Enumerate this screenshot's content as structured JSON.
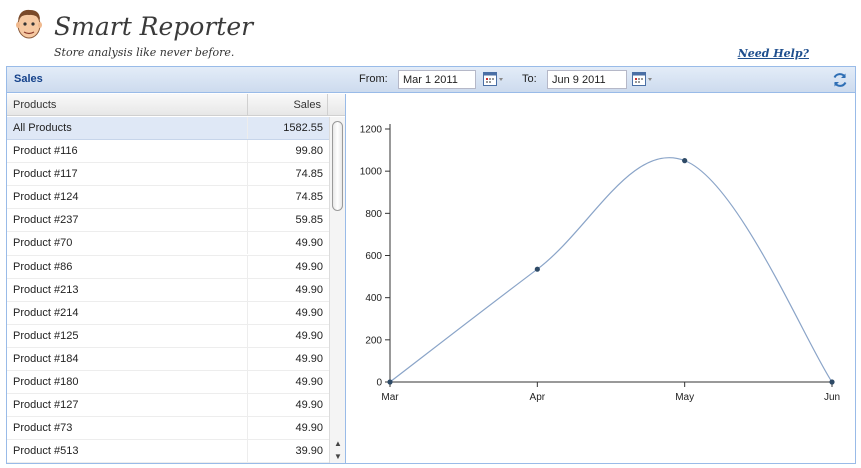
{
  "app": {
    "title": "Smart Reporter",
    "tagline": "Store analysis like never before.",
    "help_link": "Need Help?"
  },
  "toolbar": {
    "panel_title": "Sales",
    "from_label": "From:",
    "from_value": "Mar 1 2011",
    "to_label": "To:",
    "to_value": "Jun 9 2011"
  },
  "grid": {
    "columns": [
      "Products",
      "Sales"
    ],
    "rows": [
      {
        "product": "All Products",
        "sales": "1582.55",
        "selected": true
      },
      {
        "product": "Product #116",
        "sales": "99.80"
      },
      {
        "product": "Product #117",
        "sales": "74.85"
      },
      {
        "product": "Product #124",
        "sales": "74.85"
      },
      {
        "product": "Product #237",
        "sales": "59.85"
      },
      {
        "product": "Product #70",
        "sales": "49.90"
      },
      {
        "product": "Product #86",
        "sales": "49.90"
      },
      {
        "product": "Product #213",
        "sales": "49.90"
      },
      {
        "product": "Product #214",
        "sales": "49.90"
      },
      {
        "product": "Product #125",
        "sales": "49.90"
      },
      {
        "product": "Product #184",
        "sales": "49.90"
      },
      {
        "product": "Product #180",
        "sales": "49.90"
      },
      {
        "product": "Product #127",
        "sales": "49.90"
      },
      {
        "product": "Product #73",
        "sales": "49.90"
      },
      {
        "product": "Product #513",
        "sales": "39.90"
      }
    ]
  },
  "icons": {
    "mascot": "mascot-face-icon",
    "calendar": "calendar-icon",
    "refresh": "refresh-icon",
    "scroll_up": "▲",
    "scroll_down": "▼"
  },
  "colors": {
    "panel_border": "#99bbe8",
    "header_text": "#15428b",
    "selected_row": "#dfe8f6",
    "series_line": "#8aa4c8",
    "series_point": "#2e4a66",
    "link": "#1f4f8e"
  },
  "chart_data": {
    "type": "line",
    "categories": [
      "Mar",
      "Apr",
      "May",
      "Jun"
    ],
    "values": [
      0,
      535,
      1050,
      0
    ],
    "xlabel": "",
    "ylabel": "",
    "ylim": [
      0,
      1200
    ],
    "yticks": [
      0,
      200,
      400,
      600,
      800,
      1000,
      1200
    ],
    "grid": false,
    "smooth": true
  }
}
